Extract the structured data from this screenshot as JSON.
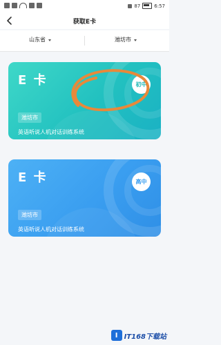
{
  "status_bar": {
    "time": "6:57",
    "battery": "87"
  },
  "header": {
    "title": "获取E卡"
  },
  "filters": {
    "province": "山东省",
    "city": "潍坊市"
  },
  "cards": [
    {
      "title": "E 卡",
      "level": "初中",
      "city": "潍坊市",
      "description": "英语听说人机对话训练系统"
    },
    {
      "title": "E 卡",
      "level": "高中",
      "city": "潍坊市",
      "description": "英语听说人机对话训练系统"
    }
  ],
  "watermark": {
    "logo": "I",
    "text": "IT168下载站"
  },
  "colors": {
    "card1": "#22c1c0",
    "card2": "#3a9ef0",
    "scribble": "#e8893a"
  }
}
